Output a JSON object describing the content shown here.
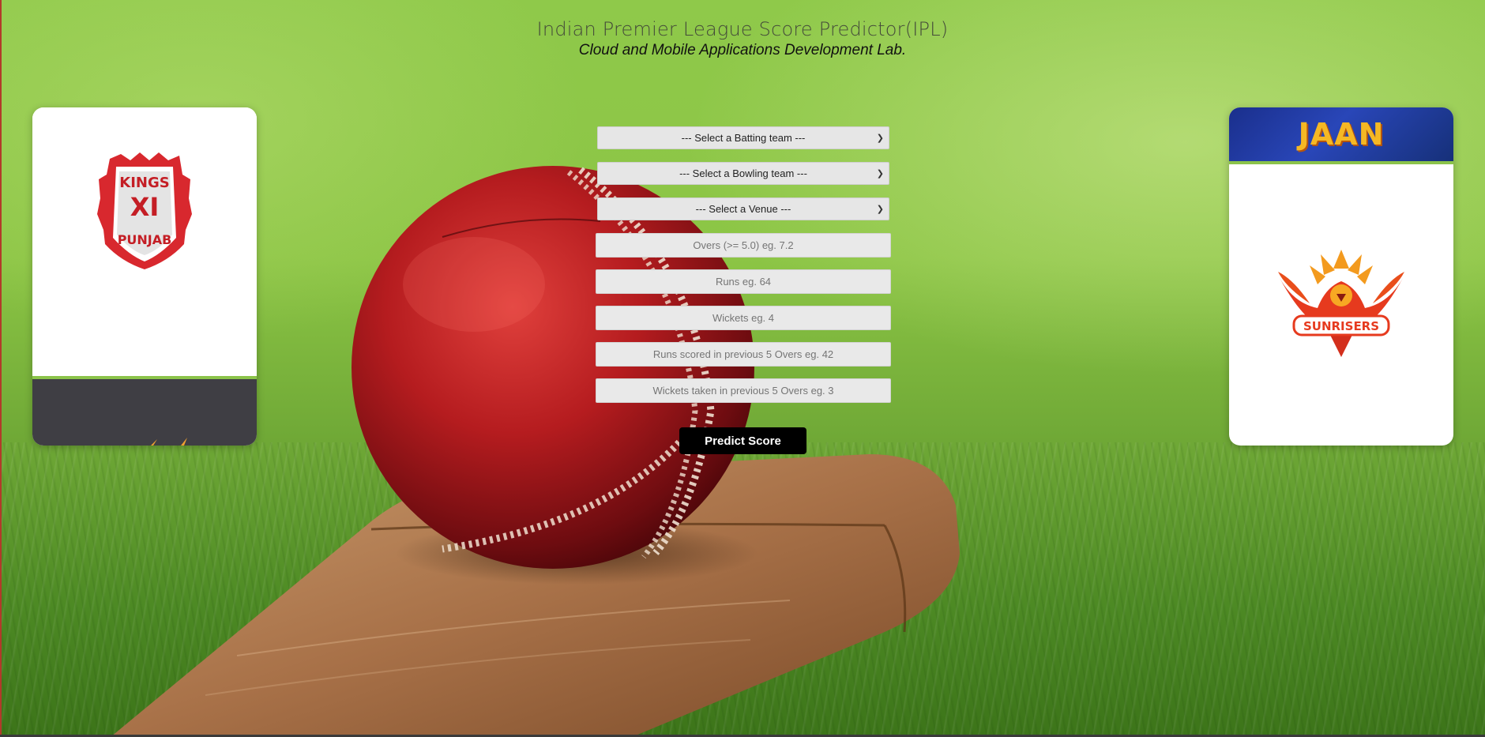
{
  "header": {
    "title": "Indian Premier League Score Predictor(IPL)",
    "subtitle": "Cloud and Mobile Applications Development Lab."
  },
  "left_card": {
    "logo_lines": [
      "KINGS",
      "XI",
      "PUNJAB"
    ],
    "logo_name": "kings-xi-punjab-logo",
    "accent_color": "#8bc34a"
  },
  "right_card": {
    "banner_text": "JAAN",
    "logo_text": "SUNRISERS",
    "logo_name": "sunrisers-logo",
    "accent_color": "#8bc34a"
  },
  "form": {
    "batting_team": "--- Select a Batting team ---",
    "bowling_team": "--- Select a Bowling team ---",
    "venue": "--- Select a Venue ---",
    "overs_placeholder": "Overs (>= 5.0) eg. 7.2",
    "runs_placeholder": "Runs eg. 64",
    "wickets_placeholder": "Wickets eg. 4",
    "runs_last5_placeholder": "Runs scored in previous 5 Overs eg. 42",
    "wickets_last5_placeholder": "Wickets taken in previous 5 Overs eg. 3",
    "submit_label": "Predict Score"
  },
  "icons": {
    "dropdown": "chevron-down-icon"
  }
}
